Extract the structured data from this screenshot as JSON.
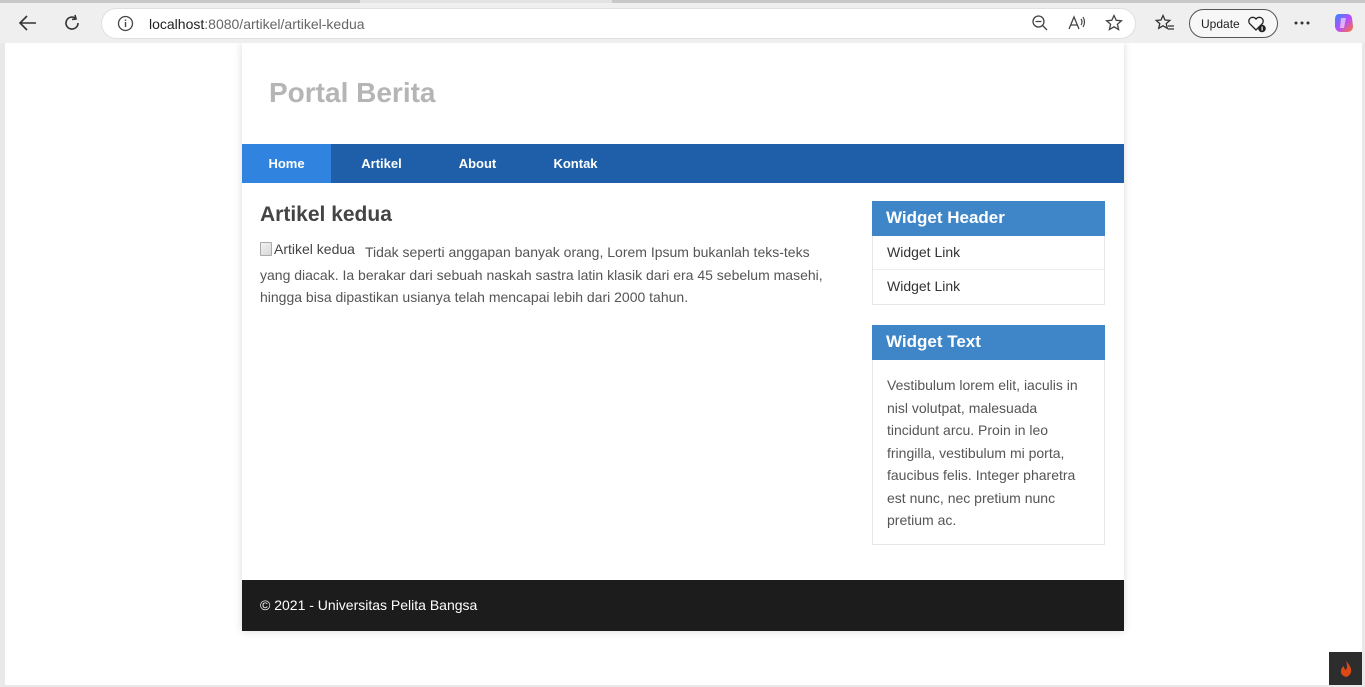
{
  "browser": {
    "url_host": "localhost",
    "url_path": ":8080/artikel/artikel-kedua",
    "update_label": "Update"
  },
  "site": {
    "title": "Portal Berita",
    "nav": [
      {
        "label": "Home",
        "active": true
      },
      {
        "label": "Artikel",
        "active": false
      },
      {
        "label": "About",
        "active": false
      },
      {
        "label": "Kontak",
        "active": false
      }
    ]
  },
  "article": {
    "title": "Artikel kedua",
    "image_alt": "Artikel kedua",
    "body": "Tidak seperti anggapan banyak orang, Lorem Ipsum bukanlah teks-teks yang diacak. Ia berakar dari sebuah naskah sastra latin klasik dari era 45 sebelum masehi, hingga bisa dipastikan usianya telah mencapai lebih dari 2000 tahun."
  },
  "sidebar": {
    "widget1": {
      "header": "Widget Header",
      "links": [
        "Widget Link",
        "Widget Link"
      ]
    },
    "widget2": {
      "header": "Widget Text",
      "text": "Vestibulum lorem elit, iaculis in nisl volutpat, malesuada tincidunt arcu. Proin in leo fringilla, vestibulum mi porta, faucibus felis. Integer pharetra est nunc, nec pretium nunc pretium ac."
    }
  },
  "footer": {
    "text": "© 2021 - Universitas Pelita Bangsa"
  },
  "colors": {
    "nav_bg": "#1f5faa",
    "nav_active": "#3183e0",
    "widget_header": "#3f86c8",
    "footer_bg": "#1c1c1c"
  }
}
